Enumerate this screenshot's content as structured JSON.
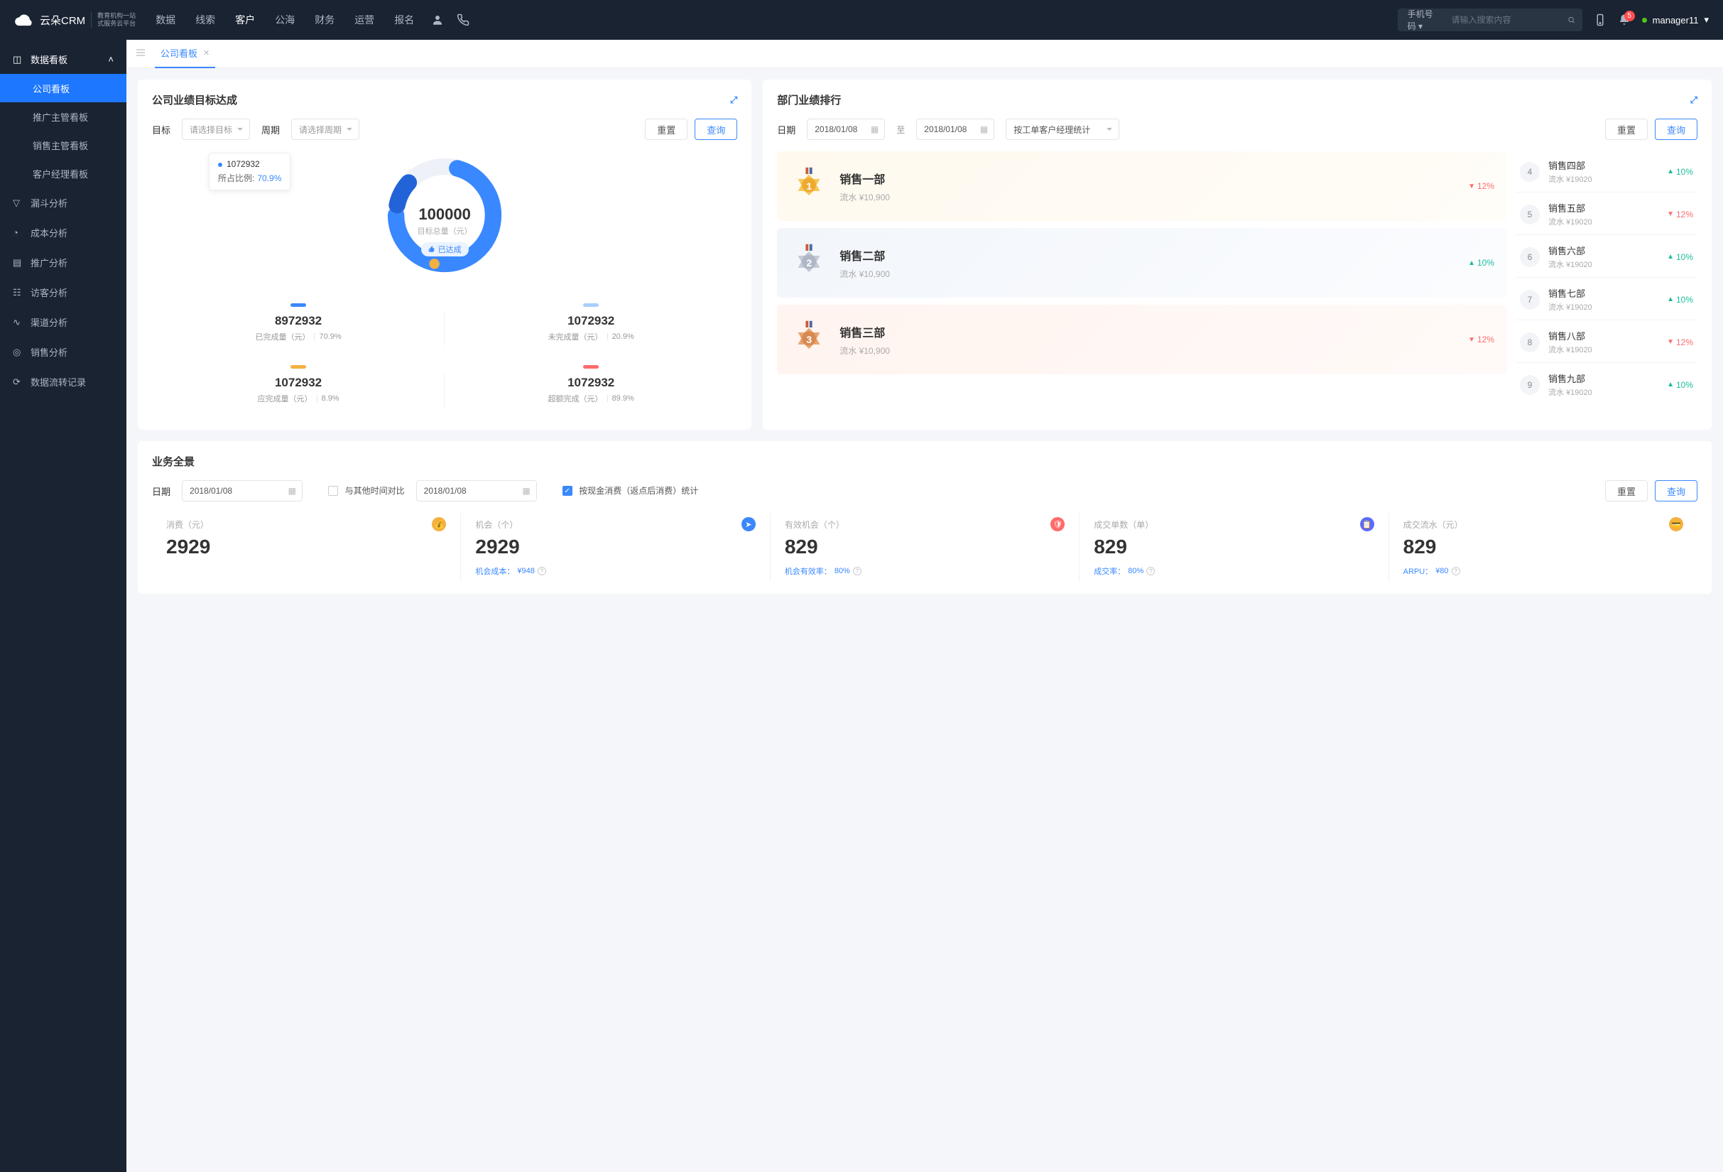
{
  "header": {
    "logo_text": "云朵CRM",
    "logo_sub1": "教育机构一站",
    "logo_sub2": "式服务云平台",
    "nav": [
      "数据",
      "线索",
      "客户",
      "公海",
      "财务",
      "运营",
      "报名"
    ],
    "nav_active_index": 2,
    "search_type": "手机号码",
    "search_placeholder": "请输入搜索内容",
    "badge": "5",
    "user": "manager11"
  },
  "sidebar": {
    "groups": [
      {
        "label": "数据看板",
        "expanded": true,
        "children": [
          "公司看板",
          "推广主管看板",
          "销售主管看板",
          "客户经理看板"
        ],
        "active_child": 0
      },
      {
        "label": "漏斗分析"
      },
      {
        "label": "成本分析"
      },
      {
        "label": "推广分析"
      },
      {
        "label": "访客分析"
      },
      {
        "label": "渠道分析"
      },
      {
        "label": "销售分析"
      },
      {
        "label": "数据流转记录"
      }
    ]
  },
  "tabs": {
    "items": [
      {
        "label": "公司看板"
      }
    ]
  },
  "target": {
    "title": "公司业绩目标达成",
    "filters": {
      "goal_label": "目标",
      "goal_ph": "请选择目标",
      "period_label": "周期",
      "period_ph": "请选择周期",
      "reset": "重置",
      "query": "查询"
    },
    "tooltip": {
      "value": "1072932",
      "ratio_label": "所占比例:",
      "ratio": "70.9%"
    },
    "center": {
      "total": "100000",
      "label": "目标总量（元）",
      "badge": "已达成"
    },
    "stats": [
      {
        "value": "8972932",
        "label": "已完成量（元）",
        "pct": "70.9%",
        "bar": "#3a88ff"
      },
      {
        "value": "1072932",
        "label": "未完成量（元）",
        "pct": "20.9%",
        "bar": "#a9cfff"
      },
      {
        "value": "1072932",
        "label": "应完成量（元）",
        "pct": "8.9%",
        "bar": "#f5b042"
      },
      {
        "value": "1072932",
        "label": "超额完成（元）",
        "pct": "89.9%",
        "bar": "#ff6b6b"
      }
    ]
  },
  "chart_data": {
    "type": "pie",
    "title": "公司业绩目标达成",
    "total_label": "目标总量（元）",
    "total": 100000,
    "series": [
      {
        "name": "已完成量（元）",
        "value": 8972932,
        "pct": 70.9,
        "color": "#3a88ff"
      },
      {
        "name": "未完成量（元）",
        "value": 1072932,
        "pct": 20.9,
        "color": "#a9cfff"
      },
      {
        "name": "应完成量（元）",
        "value": 1072932,
        "pct": 8.9,
        "color": "#f5b042"
      },
      {
        "name": "超额完成（元）",
        "value": 1072932,
        "pct": 89.9,
        "color": "#ff6b6b"
      }
    ]
  },
  "rank": {
    "title": "部门业绩排行",
    "filters": {
      "date_label": "日期",
      "date_from": "2018/01/08",
      "date_sep": "至",
      "date_to": "2018/01/08",
      "mode": "按工单客户经理统计",
      "reset": "重置",
      "query": "查询"
    },
    "top": [
      {
        "n": "1",
        "name": "销售一部",
        "sub": "流水 ¥10,900",
        "pct": "12%",
        "dir": "down"
      },
      {
        "n": "2",
        "name": "销售二部",
        "sub": "流水 ¥10,900",
        "pct": "10%",
        "dir": "up"
      },
      {
        "n": "3",
        "name": "销售三部",
        "sub": "流水 ¥10,900",
        "pct": "12%",
        "dir": "down"
      }
    ],
    "rest": [
      {
        "n": "4",
        "name": "销售四部",
        "sub": "流水 ¥19020",
        "pct": "10%",
        "dir": "up"
      },
      {
        "n": "5",
        "name": "销售五部",
        "sub": "流水 ¥19020",
        "pct": "12%",
        "dir": "down"
      },
      {
        "n": "6",
        "name": "销售六部",
        "sub": "流水 ¥19020",
        "pct": "10%",
        "dir": "up"
      },
      {
        "n": "7",
        "name": "销售七部",
        "sub": "流水 ¥19020",
        "pct": "10%",
        "dir": "up"
      },
      {
        "n": "8",
        "name": "销售八部",
        "sub": "流水 ¥19020",
        "pct": "12%",
        "dir": "down"
      },
      {
        "n": "9",
        "name": "销售九部",
        "sub": "流水 ¥19020",
        "pct": "10%",
        "dir": "up"
      }
    ]
  },
  "overview": {
    "title": "业务全景",
    "filters": {
      "date_label": "日期",
      "date1": "2018/01/08",
      "compare_label": "与其他时间对比",
      "date2": "2018/01/08",
      "chk_label": "按现金消费（返点后消费）统计",
      "reset": "重置",
      "query": "查询"
    },
    "kpis": [
      {
        "label": "消费（元）",
        "value": "2929",
        "sub_label": "",
        "sub_value": "",
        "ico_bg": "#f5b042"
      },
      {
        "label": "机会（个）",
        "value": "2929",
        "sub_label": "机会成本：",
        "sub_value": "¥948",
        "ico_bg": "#3a88ff"
      },
      {
        "label": "有效机会（个）",
        "value": "829",
        "sub_label": "机会有效率：",
        "sub_value": "80%",
        "ico_bg": "#ff6b6b"
      },
      {
        "label": "成交单数（单）",
        "value": "829",
        "sub_label": "成交率：",
        "sub_value": "80%",
        "ico_bg": "#5b6dff"
      },
      {
        "label": "成交流水（元）",
        "value": "829",
        "sub_label": "ARPU：",
        "sub_value": "¥80",
        "ico_bg": "#f5b042"
      }
    ]
  }
}
